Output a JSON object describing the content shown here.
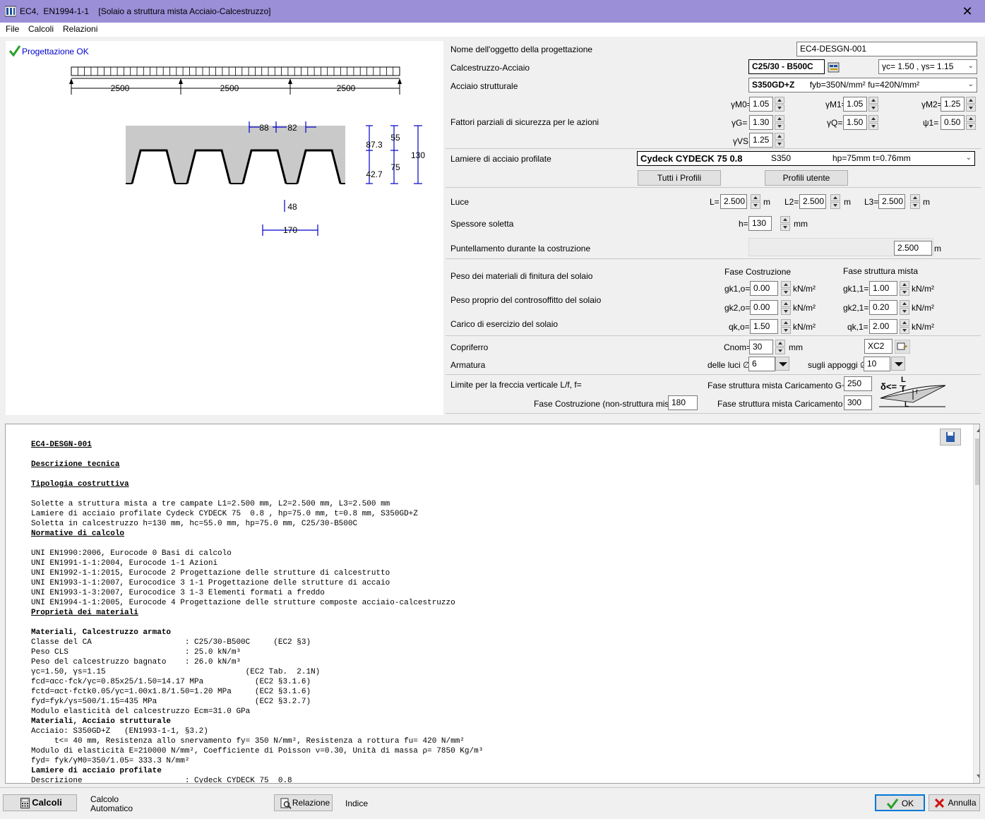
{
  "window": {
    "title": "EC4,  EN1994-1-1    [Solaio a struttura mista Acciaio-Calcestruzzo]",
    "close": "✕"
  },
  "menu": [
    "File",
    "Calcoli",
    "Relazioni"
  ],
  "status": {
    "text": "Progettazione OK",
    "color": "#0000cc"
  },
  "drawing": {
    "spans": [
      "2500",
      "2500",
      "2500"
    ],
    "dims": {
      "top_a": "88",
      "top_b": "82",
      "h_left_a": "87.3",
      "h_left_b": "42.7",
      "h_mid_a": "55",
      "h_mid_b": "75",
      "h_total": "130",
      "rib_bottom": "48",
      "pitch": "170"
    }
  },
  "form": {
    "object_name": {
      "label": "Nome dell'oggetto della progettazione",
      "value": "EC4-DESGN-001"
    },
    "concrete_steel": {
      "label": "Calcestruzzo-Acciaio",
      "value": "C25/30 - B500C",
      "gamma": "γc= 1.50 , γs= 1.15"
    },
    "structural_steel": {
      "label": "Acciaio strutturale",
      "grade": "S350GD+Z",
      "props": "fyb=350N/mm² fu=420N/mm²"
    },
    "factors": {
      "label": "Fattori parziali di sicurezza per le azioni",
      "gM0": {
        "label": "γM0=",
        "value": "1.05"
      },
      "gM1": {
        "label": "γM1=",
        "value": "1.05"
      },
      "gM2": {
        "label": "γM2=",
        "value": "1.25"
      },
      "gG": {
        "label": "γG=",
        "value": "1.30"
      },
      "gQ": {
        "label": "γQ=",
        "value": "1.50"
      },
      "psi1": {
        "label": "ψ1=",
        "value": "0.50"
      },
      "gVS": {
        "label": "γVS",
        "value": "1.25"
      }
    },
    "decking": {
      "label": "Lamiere di acciaio profilate",
      "name": "Cydeck CYDECK 75 0.8",
      "grade": "S350",
      "dims": "hp=75mm   t=0.76mm",
      "btn_all": "Tutti i Profili",
      "btn_user": "Profili utente"
    },
    "spans": {
      "label": "Luce",
      "L": {
        "label": "L=",
        "value": "2.500"
      },
      "L2": {
        "label": "L2=",
        "value": "2.500"
      },
      "L3": {
        "label": "L3=",
        "value": "2.500"
      },
      "unit": "m"
    },
    "thickness": {
      "label": "Spessore soletta",
      "h_label": "h=",
      "value": "130",
      "unit": "mm"
    },
    "propping": {
      "label": "Puntellamento durante la costruzione",
      "value": "2.500",
      "unit": "m"
    },
    "loads": {
      "col_a": "Fase Costruzione",
      "col_b": "Fase struttura mista",
      "finish_label": "Peso dei materiali di finitura del solaio",
      "ceiling_label": "Peso proprio del controsoffitto del solaio",
      "service_label": "Carico di esercizio del solaio",
      "gk1o": {
        "label": "gk1,o=",
        "value": "0.00"
      },
      "gk11": {
        "label": "gk1,1=",
        "value": "1.00"
      },
      "gk2o": {
        "label": "gk2,o=",
        "value": "0.00"
      },
      "gk21": {
        "label": "gk2,1=",
        "value": "0.20"
      },
      "qko": {
        "label": "qk,o=",
        "value": "1.50"
      },
      "qk1": {
        "label": "qk,1=",
        "value": "2.00"
      },
      "unit": "kN/m²"
    },
    "cover": {
      "label": "Copriferro",
      "cnom_label": "Cnom=",
      "value": "30",
      "unit": "mm",
      "exposure": "XC2"
    },
    "rebar": {
      "label": "Armatura",
      "span_label": "delle luci ∅",
      "span_value": "6",
      "support_label": "sugli appoggi ∅",
      "support_value": "10"
    },
    "deflection": {
      "label": "Limite per la freccia verticale L/f, f=",
      "gq_label": "Fase struttura mista Caricamento G+Q f=",
      "gq_value": "250",
      "constr_label": "Fase Costruzione (non-struttura mista) f=",
      "constr_value": "180",
      "q_label": "Fase struttura mista Caricamento Q f=",
      "q_value": "300",
      "formula_lhs": "δ<=",
      "formula_num": "L",
      "formula_den": "f",
      "L": "L",
      "f": "f"
    }
  },
  "report": {
    "title": "EC4-DESGN-001",
    "h_desc": "Descrizione tecnica",
    "h_typo": "Tipologia costruttiva",
    "typo": [
      "Solette a struttura mista a tre campate L1=2.500 mm, L2=2.500 mm, L3=2.500 mm",
      "Lamiere di acciaio profilate Cydeck CYDECK 75  0.8 , hp=75.0 mm, t=0.8 mm, S350GD+Z",
      "Soletta in calcestruzzo h=130 mm, hc=55.0 mm, hp=75.0 mm, C25/30-B500C"
    ],
    "h_norm": "Normative di calcolo",
    "norms": [
      "UNI EN1990:2006, Eurocode 0 Basi di calcolo",
      "UNI EN1991-1-1:2004, Eurocode 1-1 Azioni",
      "UNI EN1992-1-1:2015, Eurocode 2 Progettazione delle strutture di calcestrutto",
      "UNI EN1993-1-1:2007, Eurocodice 3 1-1 Progettazione delle strutture di accaio",
      "UNI EN1993-1-3:2007, Eurocodice 3 1-3 Elementi formati a freddo",
      "UNI EN1994-1-1:2005, Eurocode 4 Progettazione delle strutture composte acciaio-calcestruzzo"
    ],
    "h_prop": "Proprietà dei materiali",
    "b_conc": "Materiali, Calcestruzzo armato",
    "conc": [
      "Classe del CA                    : C25/30-B500C     (EC2 §3)",
      "Peso CLS                         : 25.0 kN/m³",
      "Peso del calcestruzzo bagnato    : 26.0 kN/m³",
      "γc=1.50, γs=1.15                              (EC2 Tab.  2.1N)",
      "fcd=αcc·fck/γc=0.85x25/1.50=14.17 MPa           (EC2 §3.1.6)",
      "fctd=αct·fctk0.05/γc=1.00x1.8/1.50=1.20 MPa     (EC2 §3.1.6)",
      "fyd=fyk/γs=500/1.15=435 MPa                     (EC2 §3.2.7)",
      "Modulo elasticità del calcestruzzo Ecm=31.0 GPa"
    ],
    "b_steel": "Materiali, Acciaio strutturale",
    "steel": [
      "Acciaio: S350GD+Z   (EN1993-1-1, §3.2)",
      "     t<= 40 mm, Resistenza allo snervamento fy= 350 N/mm², Resistenza a rottura fu= 420 N/mm²",
      "Modulo di elasticità E=210000 N/mm², Coefficiente di Poisson ν=0.30, Unità di massa ρ= 7850 Kg/m³",
      "fyd= fyk/γM0=350/1.05= 333.3 N/mm²"
    ],
    "b_deck": "Lamiere di acciaio profilate",
    "deck": "Descrizione                      : Cydeck CYDECK 75  0.8"
  },
  "bottom": {
    "calc": "Calcoli",
    "auto1": "Calcolo",
    "auto2": "Automatico",
    "report_btn": "Relazione",
    "index": "Indice",
    "ok": "OK",
    "cancel": "Annulla"
  }
}
